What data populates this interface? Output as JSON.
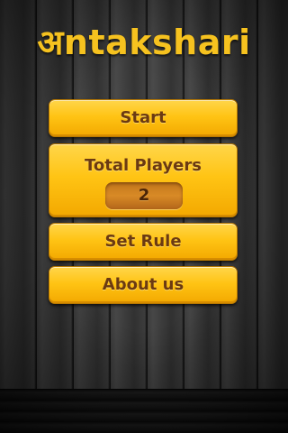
{
  "app": {
    "title": "अntakshari"
  },
  "menu": {
    "start_label": "Start",
    "total_players_label": "Total Players",
    "total_players_value": "2",
    "set_rule_label": "Set Rule",
    "about_label": "About us"
  },
  "colors": {
    "accent": "#ffc414",
    "title": "#f6c21f",
    "button_text": "#6b3a12",
    "background": "#333333"
  }
}
